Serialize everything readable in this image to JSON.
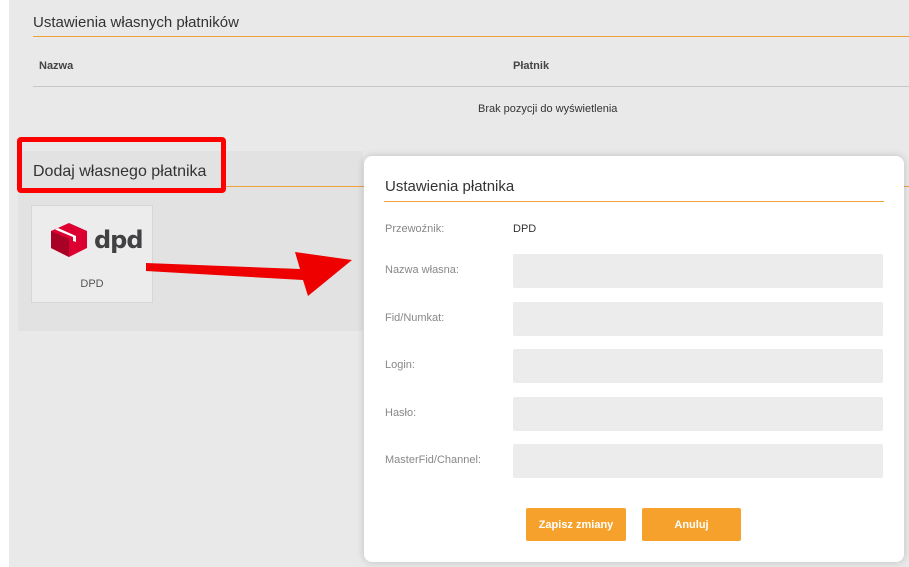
{
  "own_payers": {
    "title": "Ustawienia własnych płatników",
    "columns": [
      "Nazwa",
      "Płatnik"
    ],
    "empty_message": "Brak pozycji do wyświetlenia"
  },
  "add_payer": {
    "title": "Dodaj własnego płatnika",
    "carriers": [
      {
        "name": "DPD",
        "logo_text": "dpd",
        "logo_icon": "dpd-cube-icon",
        "logo_color": "#dc0032"
      }
    ]
  },
  "modal": {
    "title": "Ustawienia płatnika",
    "carrier_label": "Przewoźnik:",
    "carrier_value": "DPD",
    "fields": [
      {
        "label": "Nazwa własna:",
        "value": ""
      },
      {
        "label": "Fid/Numkat:",
        "value": ""
      },
      {
        "label": "Login:",
        "value": ""
      },
      {
        "label": "Hasło:",
        "value": ""
      },
      {
        "label": "MasterFid/Channel:",
        "value": ""
      }
    ],
    "save_label": "Zapisz zmiany",
    "cancel_label": "Anuluj"
  },
  "colors": {
    "accent": "#f6a12c",
    "highlight": "#ff0000",
    "background": "#e9e9e9"
  }
}
